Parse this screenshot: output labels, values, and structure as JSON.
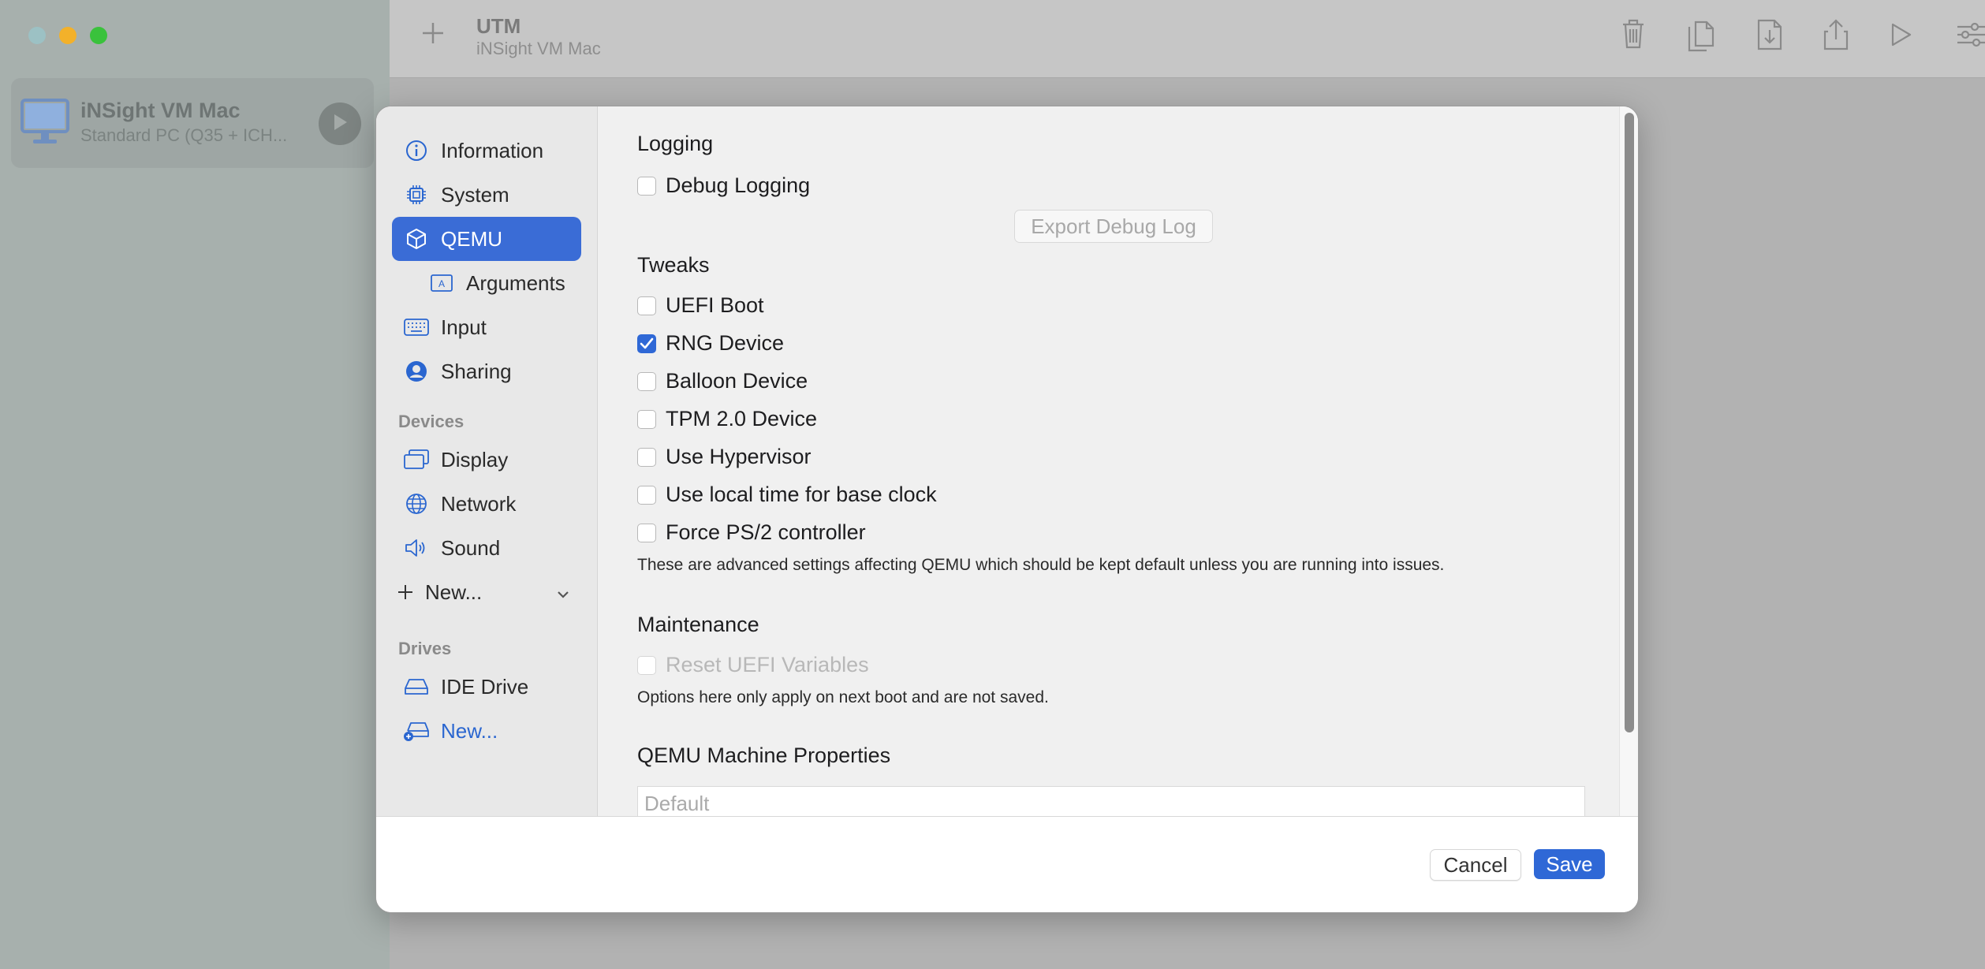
{
  "app": {
    "title": "UTM",
    "subtitle": "iNSight VM Mac"
  },
  "vm_list": [
    {
      "name": "iNSight VM Mac",
      "description": "Standard PC (Q35 + ICH..."
    }
  ],
  "toolbar": {
    "icons": [
      "plus-icon",
      "trash-icon",
      "clone-icon",
      "download-icon",
      "share-icon",
      "play-icon",
      "settings-sliders-icon"
    ]
  },
  "sidebar": {
    "items": [
      {
        "label": "Information",
        "icon": "info-circle-icon"
      },
      {
        "label": "System",
        "icon": "cpu-chip-icon"
      },
      {
        "label": "QEMU",
        "icon": "cube-icon",
        "selected": true
      },
      {
        "label": "Arguments",
        "icon": "text-box-icon"
      },
      {
        "label": "Input",
        "icon": "keyboard-icon"
      },
      {
        "label": "Sharing",
        "icon": "person-circle-icon"
      }
    ],
    "devices_label": "Devices",
    "devices": [
      {
        "label": "Display",
        "icon": "display-windows-icon"
      },
      {
        "label": "Network",
        "icon": "globe-icon"
      },
      {
        "label": "Sound",
        "icon": "speaker-icon"
      },
      {
        "label": "New...",
        "icon": "plus-icon"
      }
    ],
    "drives_label": "Drives",
    "drives": [
      {
        "label": "IDE Drive",
        "icon": "drive-icon"
      },
      {
        "label": "New...",
        "icon": "drive-add-icon"
      }
    ]
  },
  "content": {
    "logging": {
      "heading": "Logging",
      "debug_logging": {
        "label": "Debug Logging",
        "checked": false
      },
      "export_button": "Export Debug Log"
    },
    "tweaks": {
      "heading": "Tweaks",
      "options": [
        {
          "label": "UEFI Boot",
          "checked": false
        },
        {
          "label": "RNG Device",
          "checked": true
        },
        {
          "label": "Balloon Device",
          "checked": false
        },
        {
          "label": "TPM 2.0 Device",
          "checked": false
        },
        {
          "label": "Use Hypervisor",
          "checked": false
        },
        {
          "label": "Use local time for base clock",
          "checked": false
        },
        {
          "label": "Force PS/2 controller",
          "checked": false
        }
      ],
      "note": "These are advanced settings affecting QEMU which should be kept default unless you are running into issues."
    },
    "maintenance": {
      "heading": "Maintenance",
      "reset_uefi": {
        "label": "Reset UEFI Variables",
        "checked": false,
        "disabled": true
      },
      "note": "Options here only apply on next boot and are not saved."
    },
    "machine_properties": {
      "heading": "QEMU Machine Properties",
      "placeholder": "Default"
    }
  },
  "footer": {
    "cancel": "Cancel",
    "save": "Save"
  },
  "colors": {
    "accent": "#2f68d6",
    "selected_sidebar": "#3a6cd6"
  }
}
